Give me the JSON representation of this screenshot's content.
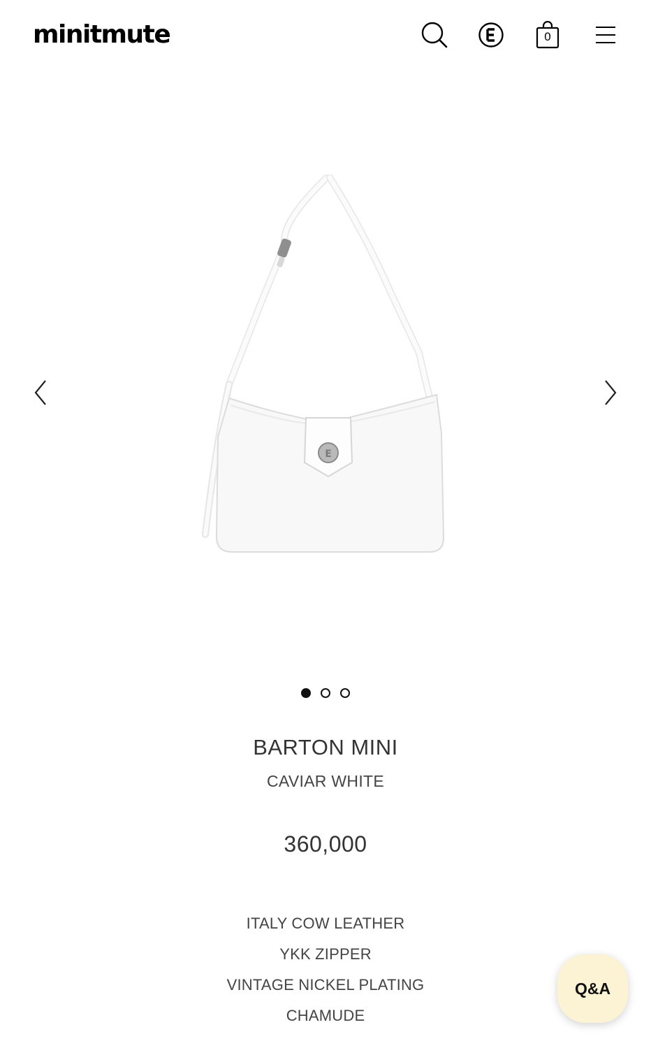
{
  "header": {
    "logo": "minitmute",
    "cart_count": "0",
    "icons": [
      "search-icon",
      "brand-e-icon",
      "shopping-bag-icon",
      "menu-icon"
    ]
  },
  "gallery": {
    "prev_icon": "chevron-left-icon",
    "next_icon": "chevron-right-icon",
    "slide_count": 3,
    "active_slide": 1
  },
  "product": {
    "name": "BARTON MINI",
    "color": "CAVIAR WHITE",
    "price": "360,000",
    "features": [
      "ITALY COW LEATHER",
      "YKK ZIPPER",
      "VINTAGE NICKEL PLATING",
      "CHAMUDE"
    ]
  },
  "qa": {
    "label": "Q&A"
  },
  "colors": {
    "qa_bg": "#fbf3d4",
    "text": "#333333",
    "dot": "#111111"
  }
}
